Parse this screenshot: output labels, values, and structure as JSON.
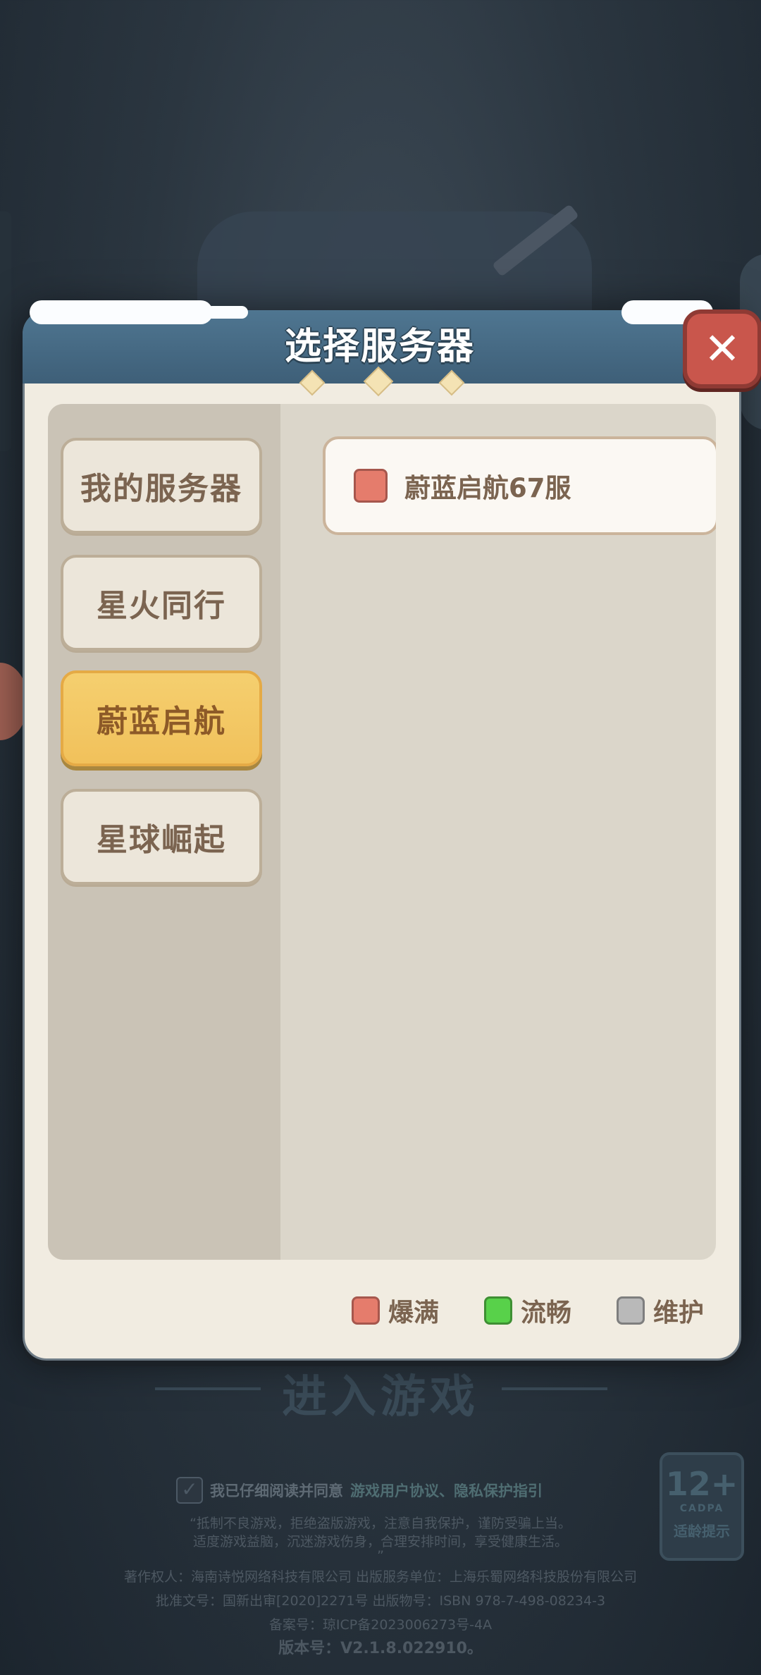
{
  "dialog": {
    "title": "选择服务器",
    "close_icon": "close-icon"
  },
  "sidebar": {
    "items": [
      {
        "label": "我的服务器",
        "active": false
      },
      {
        "label": "星火同行",
        "active": false
      },
      {
        "label": "蔚蓝启航",
        "active": true
      },
      {
        "label": "星球崛起",
        "active": false
      }
    ]
  },
  "servers": [
    {
      "name": "蔚蓝启航67服",
      "status": "爆满",
      "status_color": "#e57c6c"
    }
  ],
  "legend": [
    {
      "label": "爆满",
      "color": "#e57c6c",
      "border": "#a6574d"
    },
    {
      "label": "流畅",
      "color": "#58d14a",
      "border": "#3e8f33"
    },
    {
      "label": "维护",
      "color": "#b9b9b9",
      "border": "#7e7e7e"
    }
  ],
  "background": {
    "enter_game": "进入游戏",
    "agree_text": "我已仔细阅读并同意",
    "agree_links": "游戏用户协议、隐私保护指引",
    "notice_line1": "“抵制不良游戏，拒绝盗版游戏，注意自我保护，谨防受骗上当。",
    "notice_line2": "适度游戏益脑，沉迷游戏伤身，合理安排时间，享受健康生活。",
    "notice_line3": "”",
    "copyright": "著作权人：海南诗悦网络科技有限公司  出版服务单位：上海乐蜀网络科技股份有限公司",
    "approval": "批准文号：国新出审[2020]2271号  出版物号：ISBN 978-7-498-08234-3",
    "icp": "备案号：琼ICP备2023006273号-4A",
    "version": "版本号：V2.1.8.022910。",
    "age_rating": "12+",
    "age_org": "CADPA",
    "age_hint": "适龄提示"
  }
}
